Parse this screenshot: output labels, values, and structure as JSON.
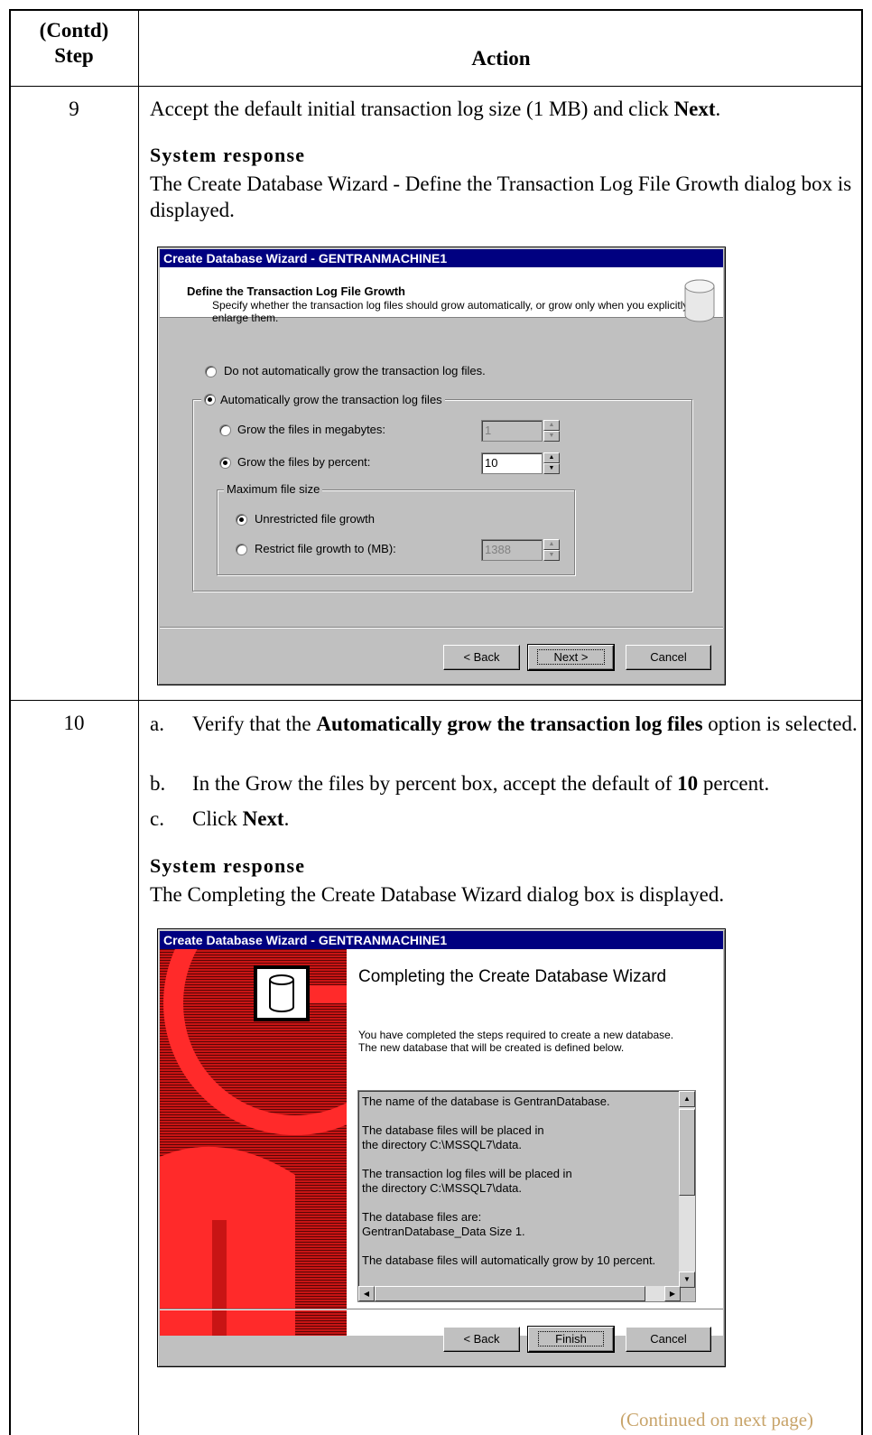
{
  "header": {
    "step_line1": "(Contd)",
    "step_line2": "Step",
    "action": "Action"
  },
  "step9": {
    "number": "9",
    "instruction_pre": "Accept the default initial transaction log size (1 MB) and click ",
    "instruction_bold": "Next",
    "instruction_post": ".",
    "system_response_heading": "System response",
    "system_response_text": "The Create Database Wizard - Define the Transaction Log File Growth dialog box is displayed.",
    "dialog": {
      "title": "Create Database Wizard - GENTRANMACHINE1",
      "header_title": "Define the Transaction Log File Growth",
      "header_desc": "Specify whether the transaction log files should grow automatically, or grow only when you explicitly enlarge them.",
      "opt_no_grow": "Do not automatically grow the transaction log files.",
      "opt_auto_grow": "Automatically grow the transaction log files",
      "opt_megabytes": "Grow the files in megabytes:",
      "megabytes_value": "1",
      "opt_percent": "Grow the files by percent:",
      "percent_value": "10",
      "max_file_size_label": "Maximum file size",
      "opt_unrestricted": "Unrestricted file growth",
      "opt_restrict": "Restrict file growth to (MB):",
      "restrict_value": "1388",
      "back_button": "< Back",
      "next_button": "Next >",
      "cancel_button": "Cancel"
    }
  },
  "step10": {
    "number": "10",
    "items": [
      {
        "label": "a.",
        "pre": "Verify that the ",
        "bold": "Automatically grow the transaction log files",
        "post": " option is selected."
      },
      {
        "label": "b.",
        "pre": "In the Grow the files by percent box, accept the default of ",
        "bold": "10",
        "post": " percent."
      },
      {
        "label": "c.",
        "pre": "Click ",
        "bold": "Next",
        "post": "."
      }
    ],
    "system_response_heading": "System response",
    "system_response_text": "The Completing the Create Database Wizard dialog box is displayed.",
    "dialog": {
      "title": "Create Database Wizard - GENTRANMACHINE1",
      "heading": "Completing the Create Database Wizard",
      "description": "You have completed the steps required to create a new database.  The new database that will be created is defined below.",
      "summary_lines": [
        "The name of the database is GentranDatabase.",
        "",
        "The database files will be placed in",
        "the directory C:\\MSSQL7\\data.",
        "",
        "The transaction log files will be placed in",
        "the directory C:\\MSSQL7\\data.",
        "",
        "The database files are:",
        "GentranDatabase_Data Size 1.",
        "",
        "The database files will automatically grow by 10 percent."
      ],
      "back_button": "< Back",
      "finish_button": "Finish",
      "cancel_button": "Cancel"
    }
  },
  "footer": {
    "continued": "(Continued on next page)"
  },
  "colors": {
    "title_bar": "#000080",
    "dialog_face": "#c0c0c0",
    "art_red": "#c81414",
    "continued_text": "#c8a46a"
  }
}
